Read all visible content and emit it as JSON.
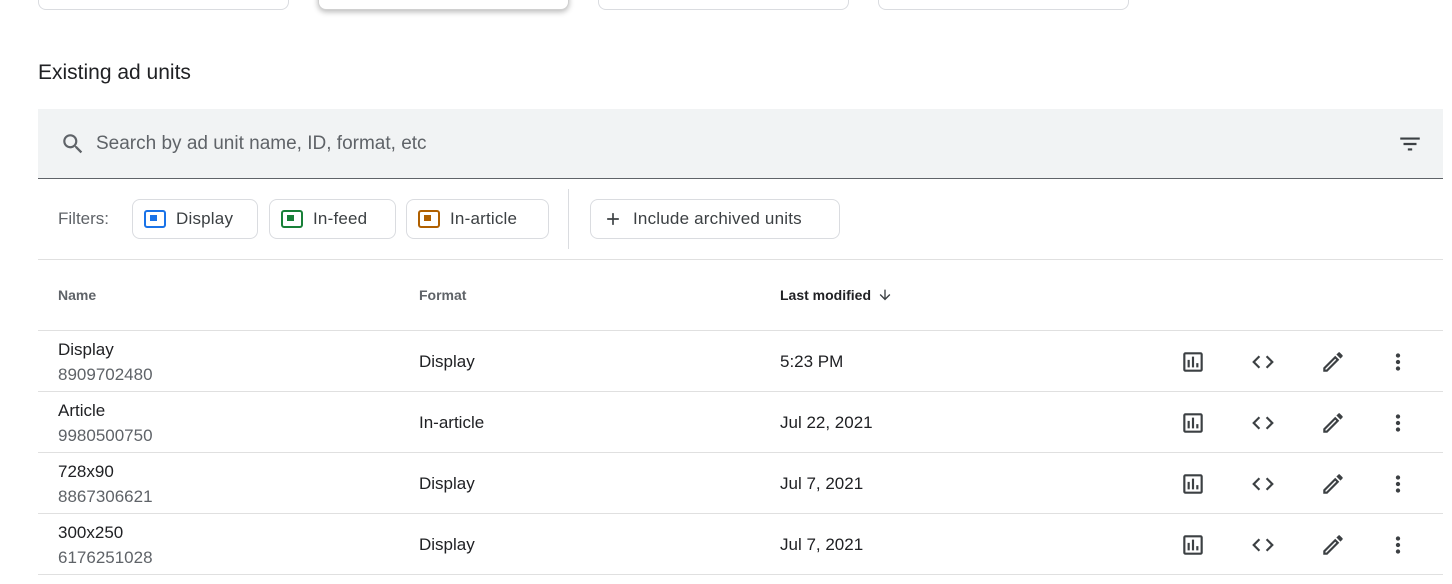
{
  "section_title": "Existing ad units",
  "search": {
    "placeholder": "Search by ad unit name, ID, format, etc",
    "value": ""
  },
  "filters": {
    "label": "Filters:",
    "chips": [
      {
        "label": "Display",
        "color": "#1a73e8"
      },
      {
        "label": "In-feed",
        "color": "#188038"
      },
      {
        "label": "In-article",
        "color": "#b06000"
      }
    ],
    "archived_label": "Include archived units"
  },
  "table": {
    "columns": {
      "name": "Name",
      "format": "Format",
      "last_modified": "Last modified"
    },
    "sort": "last_modified-descending",
    "rows": [
      {
        "name": "Display",
        "id": "8909702480",
        "format": "Display",
        "modified": "5:23 PM"
      },
      {
        "name": "Article",
        "id": "9980500750",
        "format": "In-article",
        "modified": "Jul 22, 2021"
      },
      {
        "name": "728x90",
        "id": "8867306621",
        "format": "Display",
        "modified": "Jul 7, 2021"
      },
      {
        "name": "300x250",
        "id": "6176251028",
        "format": "Display",
        "modified": "Jul 7, 2021"
      }
    ],
    "row_actions": [
      "report-icon",
      "code-icon",
      "edit-icon",
      "more-vert-icon"
    ]
  },
  "colors": {
    "icon": "#3c4043",
    "search_bg": "#f1f3f4",
    "border": "#dadce0"
  }
}
